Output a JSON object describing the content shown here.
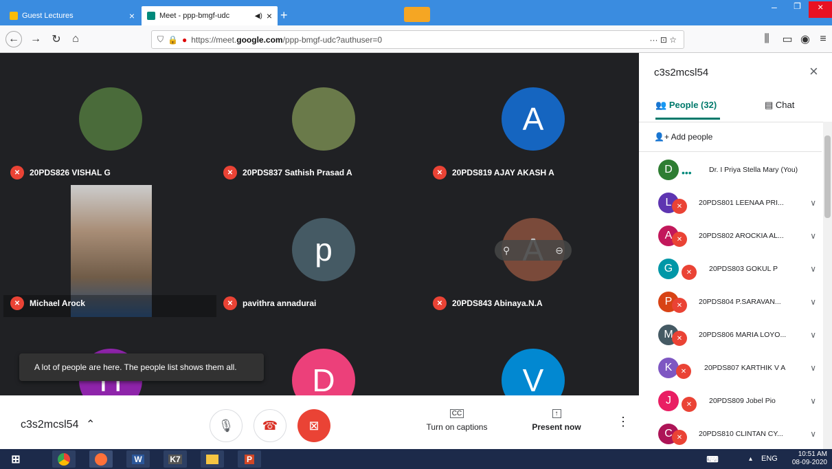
{
  "browser": {
    "tabs": [
      {
        "label": "Guest Lectures",
        "close": "×"
      },
      {
        "label": "Meet - ppp-bmgf-udc",
        "audio": "◀)",
        "close": "×"
      }
    ],
    "new_tab": "+",
    "url_prefix": "https://meet.",
    "url_domain": "google.com",
    "url_suffix": "/ppp-bmgf-udc?authuser=0",
    "page_actions": "··· ⊡ ☆"
  },
  "meet": {
    "tiles": [
      {
        "name": "20PDS826 VISHAL G",
        "type": "photo",
        "color": "#4a6b3a"
      },
      {
        "name": "20PDS837 Sathish Prasad A",
        "type": "photo",
        "color": "#6a7a4a"
      },
      {
        "name": "20PDS819 AJAY AKASH A",
        "type": "letter",
        "letter": "A",
        "color": "#1565c0"
      },
      {
        "name": "Michael Arock",
        "type": "video",
        "color": "#8a7560"
      },
      {
        "name": "pavithra annadurai",
        "type": "letter",
        "letter": "p",
        "color": "#455a64"
      },
      {
        "name": "20PDS843 Abinaya.N.A",
        "type": "letter",
        "letter": "A",
        "color": "#7a4a3a"
      },
      {
        "name": "",
        "type": "letter",
        "letter": "П",
        "color": "#8e24aa"
      },
      {
        "name": "",
        "type": "letter",
        "letter": "D",
        "color": "#ec407a"
      },
      {
        "name": "",
        "type": "letter",
        "letter": "V",
        "color": "#0288d1"
      }
    ],
    "toast": "A lot of people are here. The people list shows them all.",
    "meeting_code": "c3s2mcsl54",
    "captions_label": "Turn on captions",
    "present_label": "Present now"
  },
  "panel": {
    "title": "c3s2mcsl54",
    "tab_people": "People (32)",
    "tab_chat": "Chat",
    "add_people": "Add people",
    "people": [
      {
        "letter": "D",
        "name": "Dr. I Priya Stella Mary (You)",
        "color": "#2e7d32",
        "muted": false
      },
      {
        "letter": "L",
        "name": "20PDS801 LEENAA PRI...",
        "color": "#5e35b1",
        "muted": true
      },
      {
        "letter": "A",
        "name": "20PDS802 AROCKIA AL...",
        "color": "#c2185b",
        "muted": true
      },
      {
        "letter": "G",
        "name": "20PDS803 GOKUL P",
        "color": "#0097a7",
        "muted": true
      },
      {
        "letter": "P",
        "name": "20PDS804 P.SARAVAN...",
        "color": "#d84315",
        "muted": true
      },
      {
        "letter": "M",
        "name": "20PDS806 MARIA LOYO...",
        "color": "#455a64",
        "muted": true
      },
      {
        "letter": "K",
        "name": "20PDS807 KARTHIK V A",
        "color": "#7e57c2",
        "muted": true
      },
      {
        "letter": "J",
        "name": "20PDS809 Jobel Pio",
        "color": "#e91e63",
        "muted": true
      },
      {
        "letter": "C",
        "name": "20PDS810 CLINTAN CY...",
        "color": "#ad1457",
        "muted": true
      }
    ]
  },
  "taskbar": {
    "time": "10:51 AM",
    "date": "08-09-2020",
    "lang": "ENG",
    "apps": [
      "chrome",
      "firefox",
      "word",
      "k7",
      "files",
      "powerpoint"
    ]
  }
}
